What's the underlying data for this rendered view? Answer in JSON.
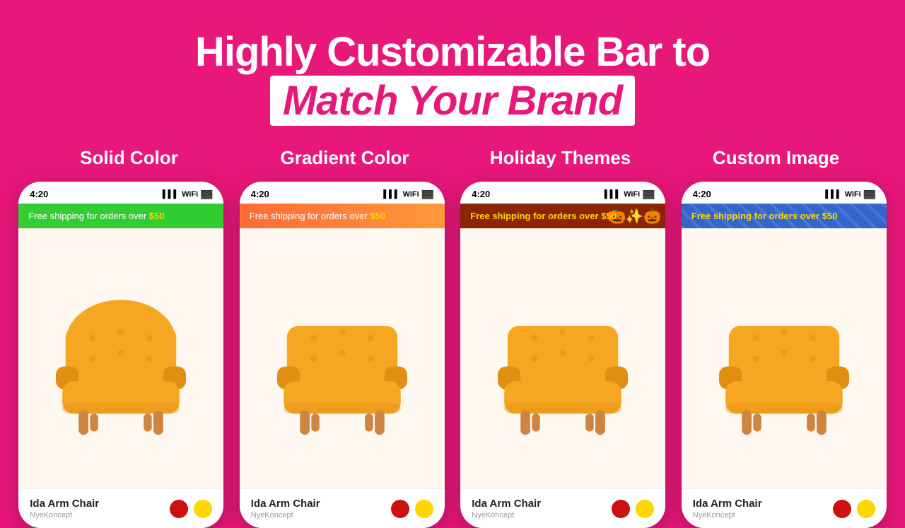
{
  "header": {
    "prefix": "Highly Customizable Bar to",
    "highlight": "Match Your Brand"
  },
  "categories": [
    {
      "label": "Solid Color"
    },
    {
      "label": "Gradient Color"
    },
    {
      "label": "Holiday Themes"
    },
    {
      "label": "Custom Image"
    }
  ],
  "phones": [
    {
      "id": "solid",
      "status_time": "4:20",
      "notif_class": "notif-solid",
      "notif_text": "Free shipping for orders over",
      "notif_amount": "$50",
      "product_name": "Ida Arm Chair",
      "product_brand": "NyeKoncept"
    },
    {
      "id": "gradient",
      "status_time": "4:20",
      "notif_class": "notif-gradient",
      "notif_text": "Free shipping for orders over",
      "notif_amount": "$50",
      "product_name": "Ida Arm Chair",
      "product_brand": "NyeKoncept"
    },
    {
      "id": "holiday",
      "status_time": "4:20",
      "notif_class": "notif-holiday",
      "notif_text": "Free shipping for orders over",
      "notif_amount": "$50",
      "product_name": "Ida Arm Chair",
      "product_brand": "NyeKoncept"
    },
    {
      "id": "custom",
      "status_time": "4:20",
      "notif_class": "notif-custom",
      "notif_text": "Free shipping for orders over",
      "notif_amount": "$50",
      "product_name": "Ida Arm Chair",
      "product_brand": "NyeKoncept"
    }
  ]
}
